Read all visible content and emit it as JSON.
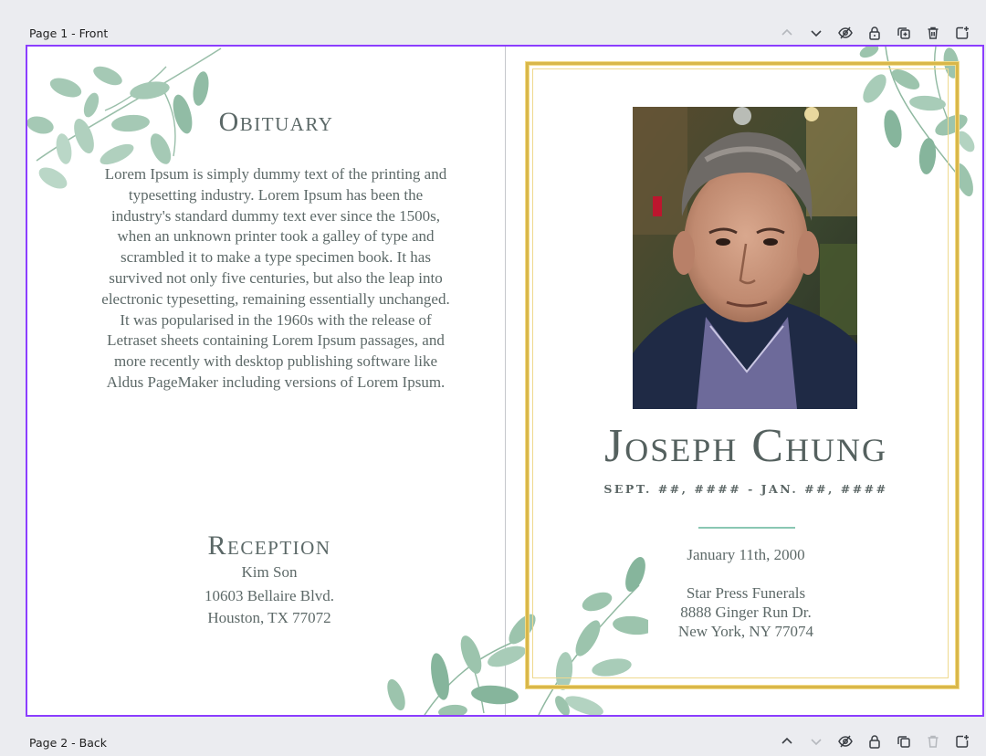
{
  "pages": [
    {
      "label": "Page 1 - Front"
    },
    {
      "label": "Page 2 - Back"
    }
  ],
  "toolbar_icons": [
    "chevron-up-icon",
    "chevron-down-icon",
    "hide-icon",
    "lock-icon",
    "duplicate-icon",
    "trash-icon",
    "add-page-icon"
  ],
  "card": {
    "obituary_title": "Obituary",
    "obituary_lines": [
      "Lorem Ipsum is simply dummy text of the printing and",
      "typesetting industry. Lorem Ipsum has been the",
      "industry's standard dummy text ever since the 1500s,",
      "when an unknown printer took a galley of type and",
      "scrambled it to make a type specimen book. It has",
      "survived not only five centuries, but also the leap into",
      "electronic typesetting, remaining essentially unchanged.",
      "It was popularised in the 1960s with the release of",
      "Letraset sheets containing Lorem Ipsum passages, and",
      "more recently with desktop publishing software like",
      "Aldus PageMaker including versions of Lorem Ipsum."
    ],
    "reception_title": "Reception",
    "reception_name": "Kim Son",
    "reception_address1": "10603 Bellaire Blvd.",
    "reception_address2": "Houston, TX 77072",
    "name": "Joseph Chung",
    "dates": "SEPT. ##, #### - JAN. ##, ####",
    "service_date": "January 11th, 2000",
    "venue": "Star Press Funerals",
    "venue_address1": "8888 Ginger Run Dr.",
    "venue_address2": "New York, NY 77074"
  },
  "colors": {
    "selection": "#8b3dff",
    "gold": "#d9b74a",
    "text": "#5b6867",
    "divider": "#8ac7b3",
    "leaf": "#9cc4ad"
  }
}
